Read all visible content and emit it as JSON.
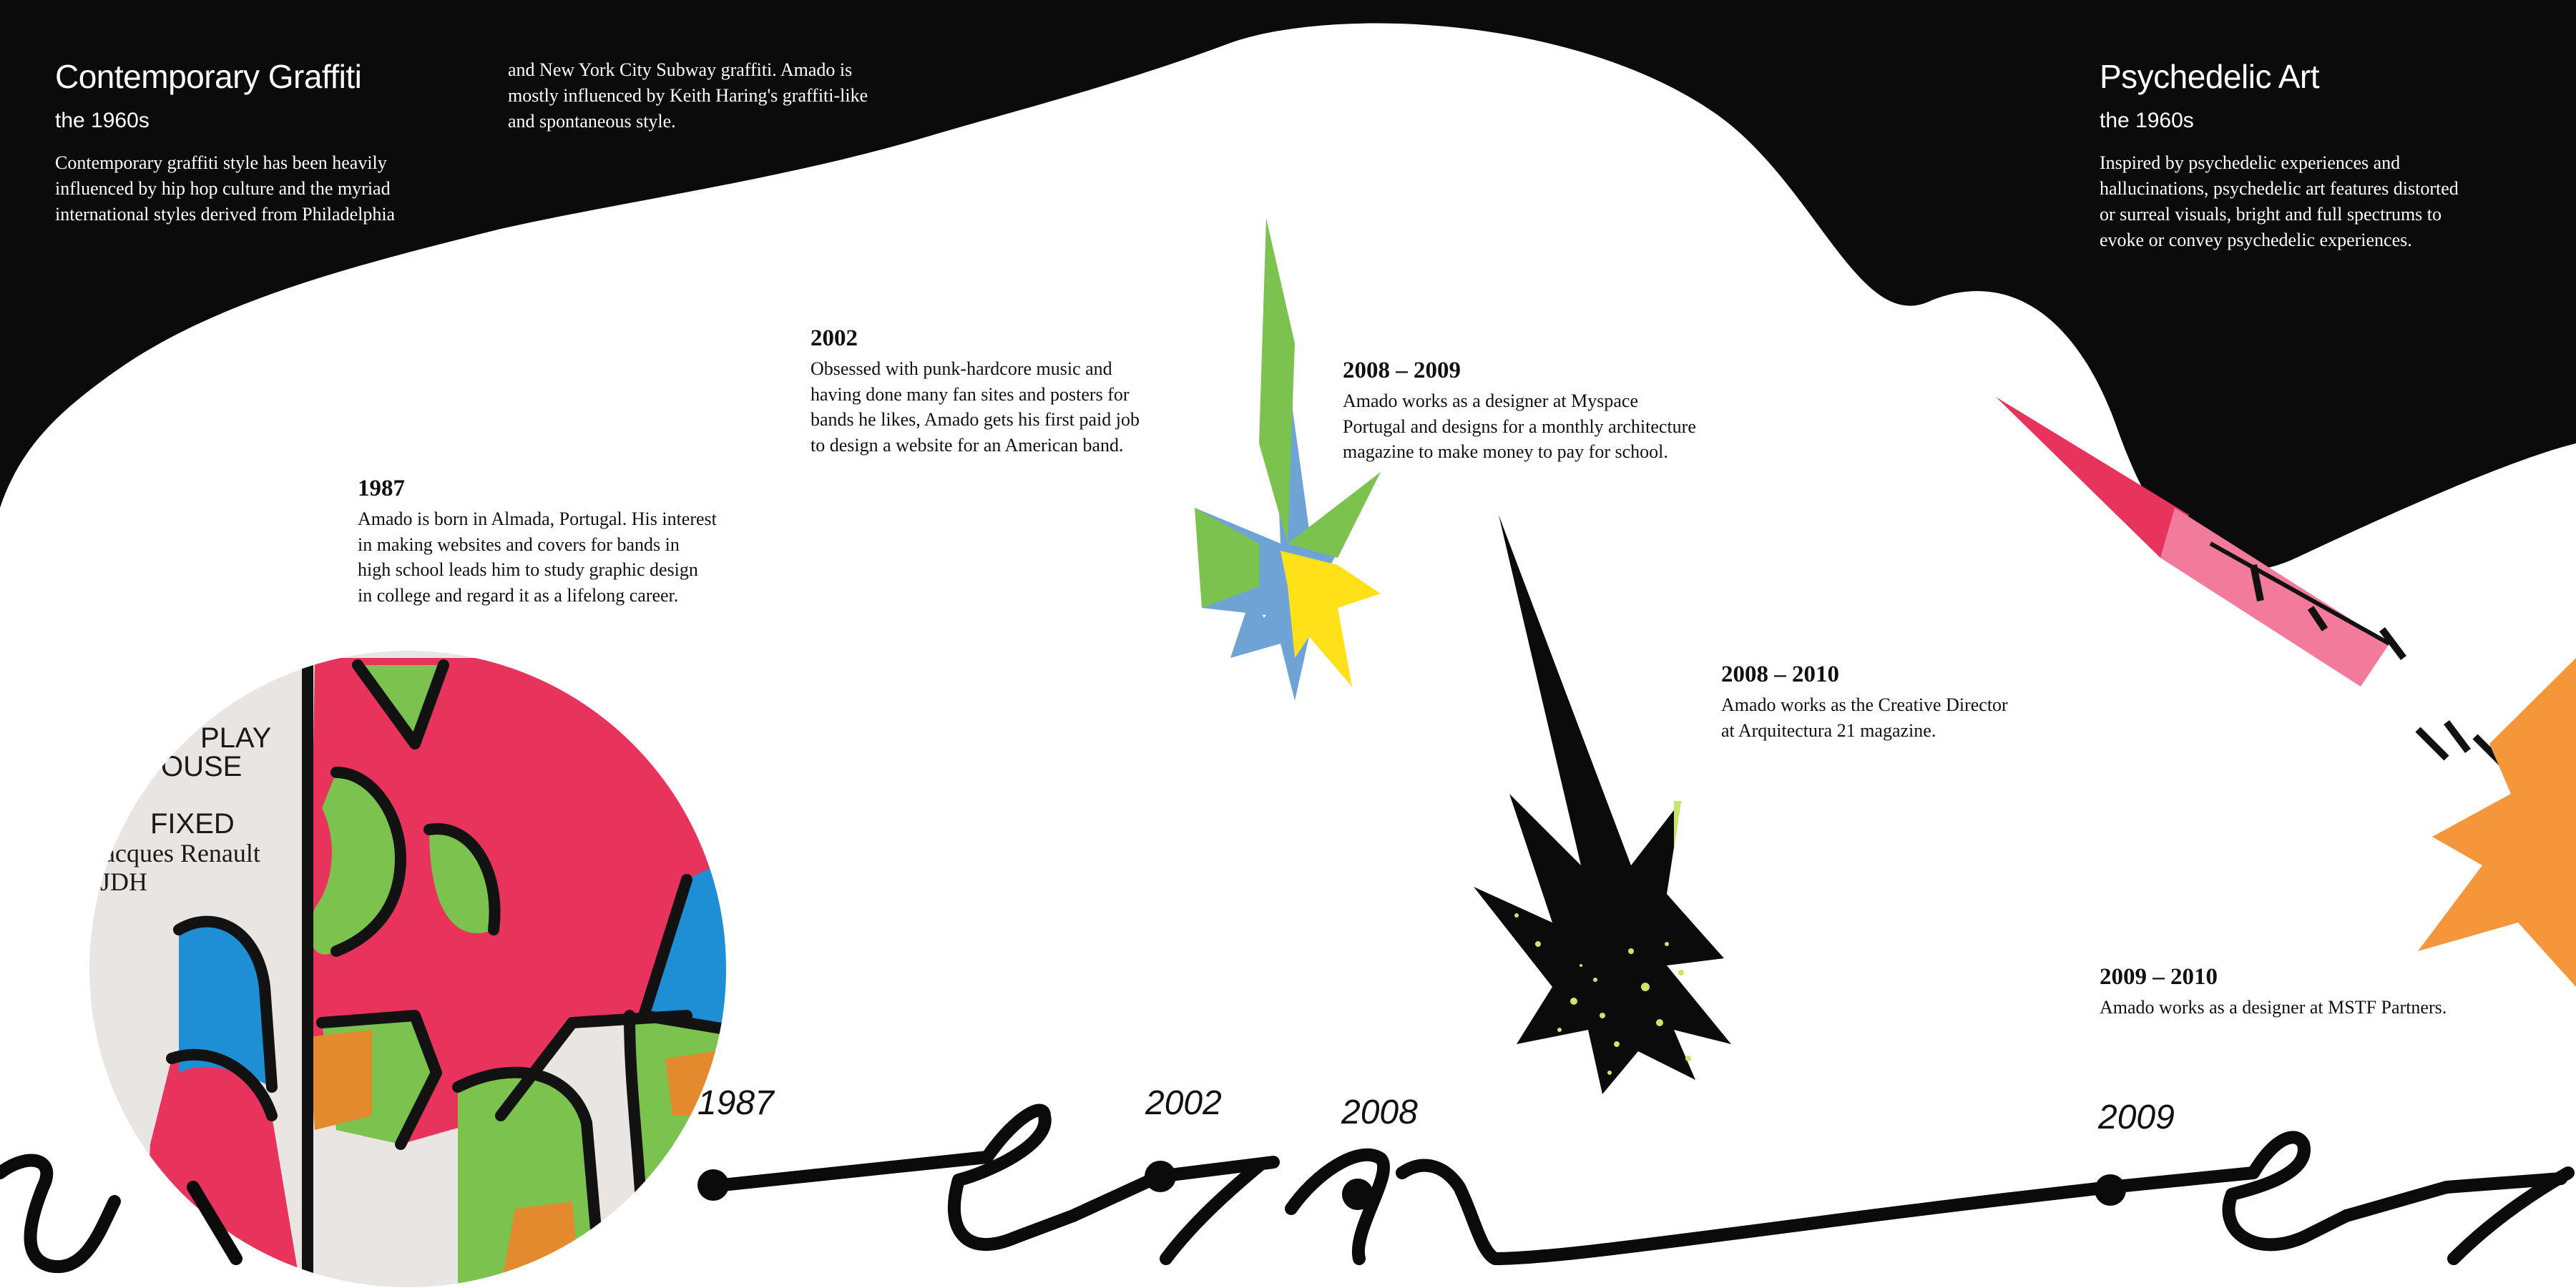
{
  "colors": {
    "black": "#0b0b0b",
    "white": "#ffffff",
    "pink": "#e8345d",
    "green": "#7cc24f",
    "blue": "#1e8fd4",
    "orange": "#e48a2e",
    "yellow": "#ffe11a",
    "lime": "#c8e66a",
    "sky": "#6fa3d6",
    "orange_star": "#f5963a"
  },
  "left_panel": {
    "title": "Contemporary Graffiti",
    "subtitle": "the 1960s",
    "body": "Contemporary graffiti style has been heavily\ninfluenced by hip hop culture and the myriad\ninternational styles derived from Philadelphia",
    "continuation": "and New York City Subway graffiti. Amado is\nmostly influenced by Keith Haring's graffiti-like\nand spontaneous style."
  },
  "right_panel": {
    "title": "Psychedelic Art",
    "subtitle": "the 1960s",
    "body": "Inspired by psychedelic experiences and\nhallucinations, psychedelic art features distorted\nor surreal visuals, bright and full spectrums to\nevoke or convey psychedelic experiences."
  },
  "events": [
    {
      "year": "1987",
      "text": "Amado is born in Almada, Portugal. His interest\nin making websites and covers for bands in\nhigh school leads him to study graphic design\nin college and regard it as a lifelong career."
    },
    {
      "year": "2002",
      "text": "Obsessed with punk-hardcore music and\nhaving done many fan sites and posters for\nbands he likes, Amado gets his first paid job\nto design a website for an American band."
    },
    {
      "year": "2008 – 2009",
      "text": "Amado works as a designer at Myspace\nPortugal and designs for a monthly architecture\nmagazine to make money to pay for school."
    },
    {
      "year": "2008 – 2010",
      "text": "Amado works as the Creative Director\nat Arquitectura 21 magazine."
    },
    {
      "year": "2009 – 2010",
      "text": "Amado works as a designer at MSTF Partners."
    }
  ],
  "timeline_labels": [
    "1987",
    "2002",
    "2008",
    "2009"
  ],
  "poster": {
    "line1": "PLAY",
    "line2": "OUSE",
    "line3": "FIXED",
    "line4": "acques Renault",
    "line5": "JDH"
  }
}
